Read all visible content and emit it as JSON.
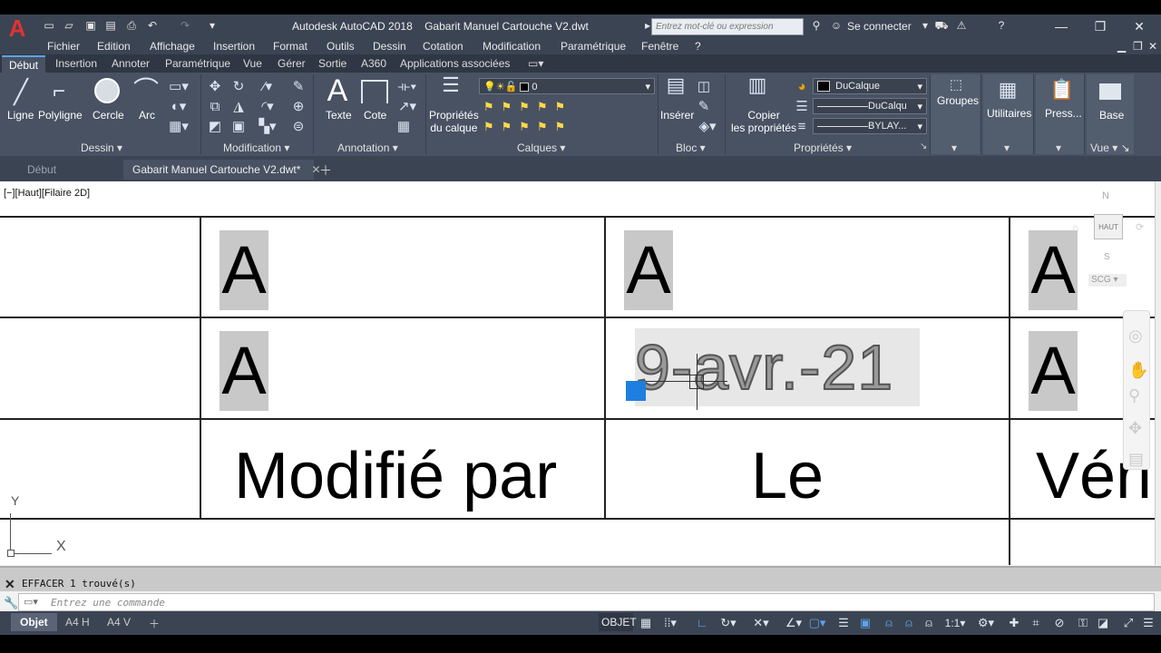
{
  "window": {
    "title": "Autodesk AutoCAD 2018    Gabarit Manuel Cartouche V2.dwt",
    "search_placeholder": "Entrez mot-clé ou expression",
    "signin": "Se connecter"
  },
  "menubar": [
    "Fichier",
    "Edition",
    "Affichage",
    "Insertion",
    "Format",
    "Outils",
    "Dessin",
    "Cotation",
    "Modification",
    "Paramétrique",
    "Fenêtre",
    "?"
  ],
  "ribbon_tabs": [
    "Début",
    "Insertion",
    "Annoter",
    "Paramétrique",
    "Vue",
    "Gérer",
    "Sortie",
    "A360",
    "Applications associées"
  ],
  "ribbon": {
    "draw": {
      "line": "Ligne",
      "polyline": "Polyligne",
      "circle": "Cercle",
      "arc": "Arc",
      "panel": "Dessin"
    },
    "modify": {
      "panel": "Modification"
    },
    "annotation": {
      "text": "Texte",
      "dim": "Cote",
      "panel": "Annotation"
    },
    "layers": {
      "props1": "Propriétés",
      "props2": "du calque",
      "current": "0",
      "panel": "Calques"
    },
    "block": {
      "insert": "Insérer",
      "panel": "Bloc"
    },
    "properties": {
      "copy1": "Copier",
      "copy2": "les propriétés",
      "color": "DuCalque",
      "linetype": "DuCalqu",
      "lineweight": "BYLAY...",
      "panel": "Propriétés"
    },
    "groups": "Groupes",
    "utilities": "Utilitaires",
    "clipboard": "Press...",
    "base": "Base",
    "view": "Vue"
  },
  "doc_tabs": {
    "start": "Début",
    "current": "Gabarit Manuel Cartouche V2.dwt*"
  },
  "viewport": {
    "label": "[−][Haut][Filaire 2D]",
    "cube": "HAUT",
    "north": "N",
    "south": "S",
    "ucs": "SCG"
  },
  "drawing": {
    "attr": "A",
    "date": "9-avr.-21",
    "row3": [
      "Modifié par",
      "Le",
      "Véri"
    ],
    "ucs_x": "X",
    "ucs_y": "Y"
  },
  "command": {
    "history": "EFFACER 1 trouvé(s)",
    "placeholder": "Entrez une commande"
  },
  "status": {
    "layouts": [
      "Objet",
      "A4 H",
      "A4 V"
    ],
    "model": "OBJET",
    "scale": "1:1"
  }
}
